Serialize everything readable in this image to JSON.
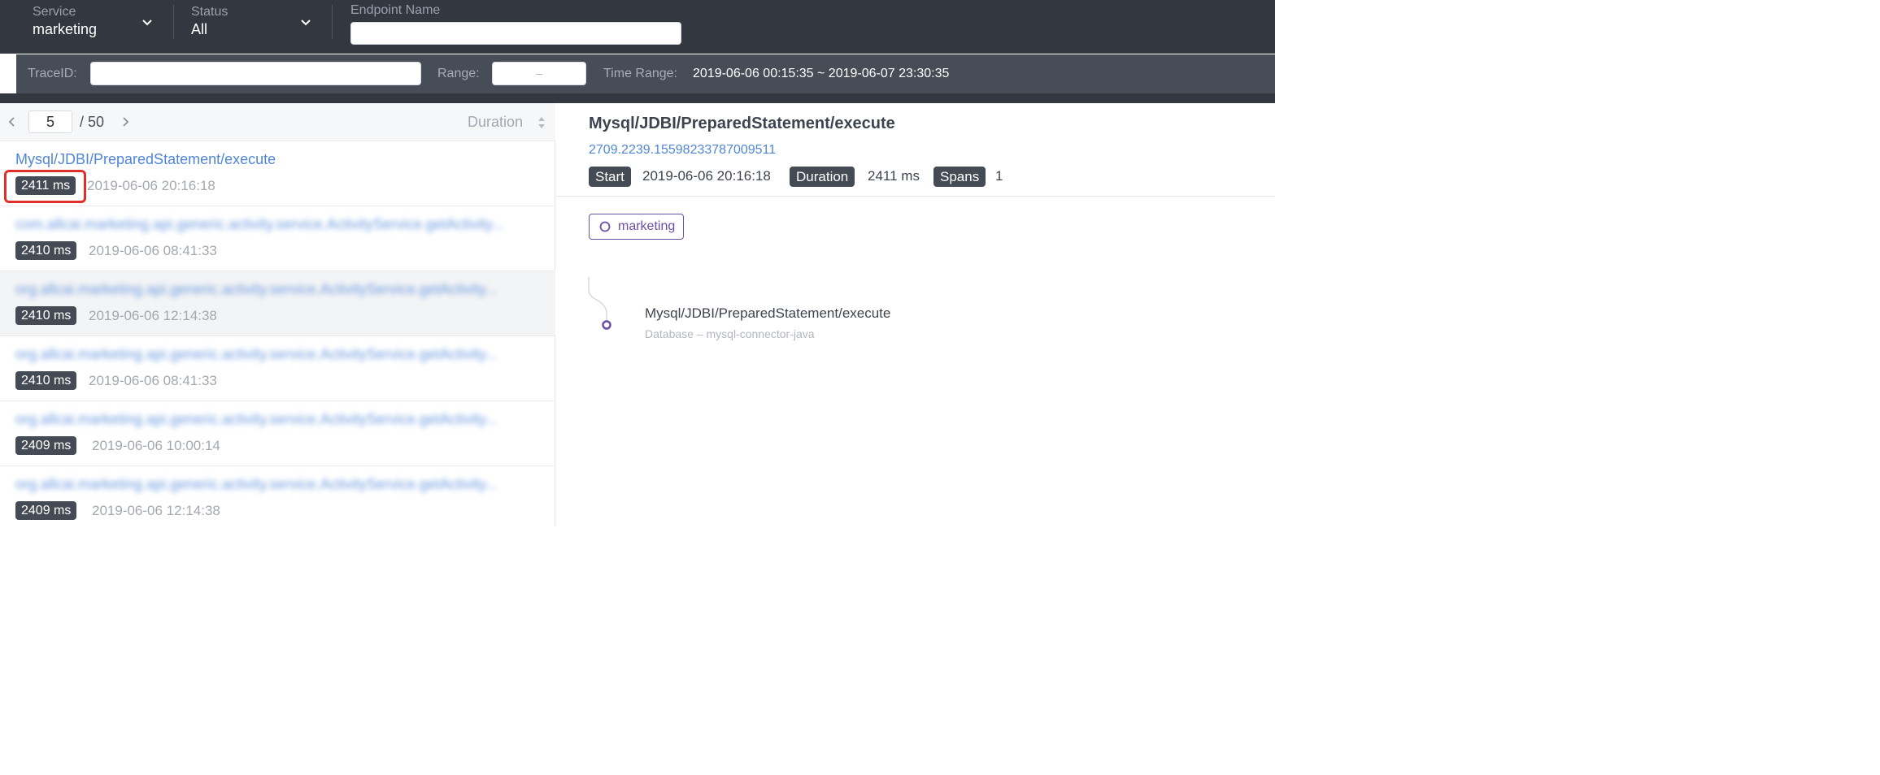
{
  "filters": {
    "service": {
      "label": "Service",
      "value": "marketing"
    },
    "status": {
      "label": "Status",
      "value": "All"
    },
    "endpoint": {
      "label": "Endpoint Name",
      "value": ""
    },
    "trace_id": {
      "label": "TraceID:",
      "value": ""
    },
    "range": {
      "label": "Range:",
      "value": "–"
    },
    "time_range": {
      "label": "Time Range:",
      "value": "2019-06-06 00:15:35 ~ 2019-06-07 23:30:35"
    }
  },
  "list": {
    "pager": {
      "current_page": "5",
      "total": "/ 50"
    },
    "sort": {
      "label": "Duration"
    },
    "items": [
      {
        "title": "Mysql/JDBI/PreparedStatement/execute",
        "duration": "2411 ms",
        "time": "2019-06-06 20:16:18"
      },
      {
        "title": "com.allcai.marketing.api.generic.activity.service.ActivityService.getActivity...",
        "duration": "2410 ms",
        "time": "2019-06-06 08:41:33"
      },
      {
        "title": "org.allcai.marketing.api.generic.activity.service.ActivityService.getActivity...",
        "duration": "2410 ms",
        "time": "2019-06-06 12:14:38"
      },
      {
        "title": "org.allcai.marketing.api.generic.activity.service.ActivityService.getActivity...",
        "duration": "2410 ms",
        "time": "2019-06-06 08:41:33"
      },
      {
        "title": "org.allcai.marketing.api.generic.activity.service.ActivityService.getActivity...",
        "duration": "2409 ms",
        "time": "2019-06-06 10:00:14"
      },
      {
        "title": "org.allcai.marketing.api.generic.activity.service.ActivityService.getActivity...",
        "duration": "2409 ms",
        "time": "2019-06-06 12:14:38"
      }
    ]
  },
  "detail": {
    "title": "Mysql/JDBI/PreparedStatement/execute",
    "trace_id": "2709.2239.15598233787009511",
    "start_label": "Start",
    "start_value": "2019-06-06 20:16:18",
    "duration_label": "Duration",
    "duration_value": "2411 ms",
    "spans_label": "Spans",
    "spans_value": "1",
    "service_tag": "marketing",
    "span": {
      "name": "Mysql/JDBI/PreparedStatement/execute",
      "component": "Database – mysql-connector-java"
    }
  },
  "colors": {
    "topbar": "#333840",
    "filterbar": "#474d57",
    "link": "#4f86d8",
    "badge": "#454b55",
    "service_tag": "#6a4fa6",
    "highlight": "#e02f2a"
  },
  "icons": [
    "chevron-down-icon",
    "chevron-left-icon",
    "chevron-right-icon",
    "sort-icon",
    "circle-icon"
  ]
}
